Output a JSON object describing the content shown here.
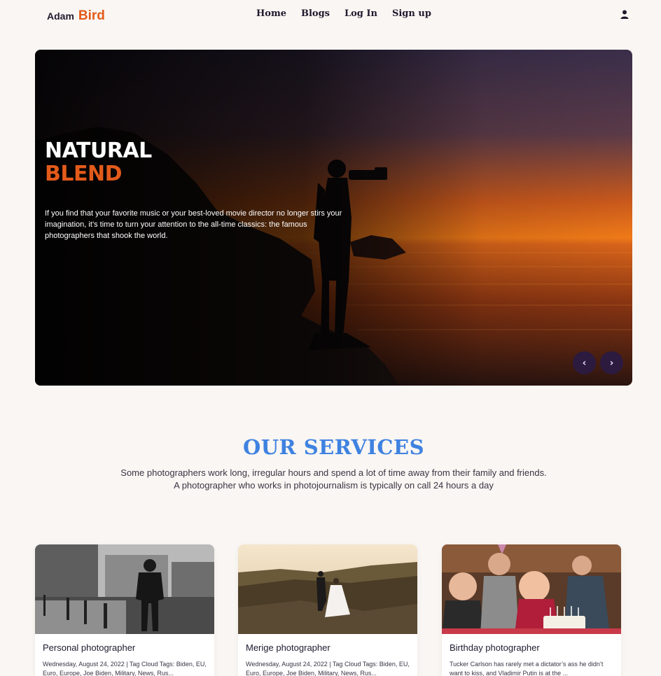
{
  "brand": {
    "first": "Adam",
    "last": "Bird"
  },
  "nav": {
    "items": [
      "Home",
      "Blogs",
      "Log In",
      "Sign up"
    ],
    "user_icon": "user-icon"
  },
  "hero": {
    "title_line1": "NATURAL",
    "title_line2": "BLEND",
    "text": "If you find that your favorite music or your best-loved movie director no longer stirs your imagination, it’s time to turn your attention to the all-time classics: the famous photographers that shook the world.",
    "prev_label": "‹",
    "next_label": "›"
  },
  "services": {
    "title": "OUR SERVICES",
    "text": "Some photographers work long, irregular hours and spend a lot of time away from their family and friends. A photographer who works in photojournalism is typically on call 24 hours a day"
  },
  "cards": [
    {
      "title": "Personal photographer",
      "text": "Wednesday, August 24, 2022 | Tag Cloud Tags: Biden, EU, Euro, Europe, Joe Biden, Military, News, Rus..."
    },
    {
      "title": "Merige photographer",
      "text": "Wednesday, August 24, 2022 | Tag Cloud Tags: Biden, EU, Euro, Europe, Joe Biden, Military, News, Rus..."
    },
    {
      "title": "Birthday photographer",
      "text": "Tucker Carlson has rarely met a dictator’s ass he didn’t want to kiss, and Vladimir Putin is at the ..."
    }
  ],
  "colors": {
    "accent": "#e35a1a",
    "services_title": "#3f82e0",
    "background": "#faf6f3",
    "carousel_button": "#2c1a3f"
  }
}
